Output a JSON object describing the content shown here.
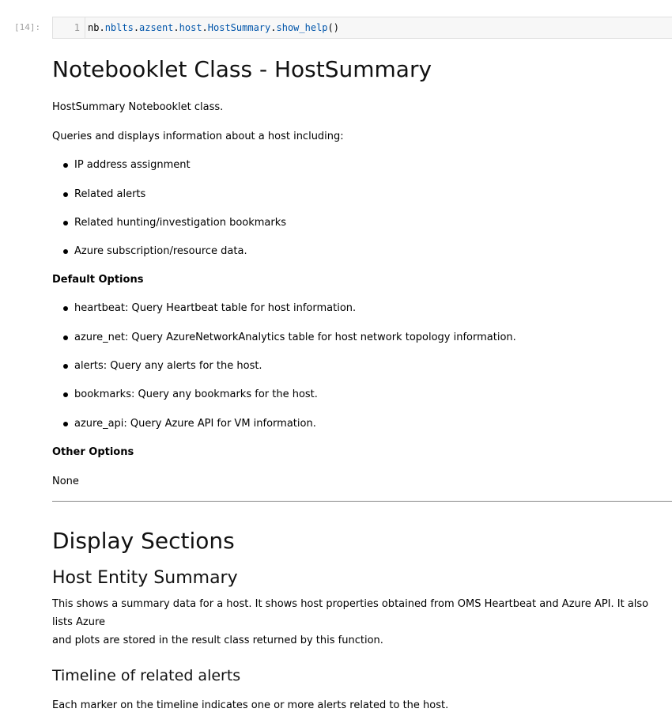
{
  "cell": {
    "prompt": "[14]:",
    "line_number": "1",
    "code_parts": [
      "nb.",
      "nblts",
      ".",
      "azsent",
      ".",
      "host",
      ".",
      "HostSummary",
      ".",
      "show_help",
      "()"
    ]
  },
  "doc": {
    "title": "Notebooklet Class - HostSummary",
    "intro1": "HostSummary Notebooklet class.",
    "intro2": "Queries and displays information about a host including:",
    "features": [
      "IP address assignment",
      "Related alerts",
      "Related hunting/investigation bookmarks",
      "Azure subscription/resource data."
    ],
    "default_options_heading": "Default Options",
    "default_options": [
      "heartbeat: Query Heartbeat table for host information.",
      "azure_net: Query AzureNetworkAnalytics table for host network topology information.",
      "alerts: Query any alerts for the host.",
      "bookmarks: Query any bookmarks for the host.",
      "azure_api: Query Azure API for VM information."
    ],
    "other_options_heading": "Other Options",
    "other_options_value": "None",
    "display_sections_heading": "Display Sections",
    "host_entity_heading": "Host Entity Summary",
    "host_entity_line1": "This shows a summary data for a host. It shows host properties obtained from OMS Heartbeat and Azure API. It also lists Azure",
    "host_entity_line2": "and plots are stored in the result class returned by this function.",
    "timeline_heading": "Timeline of related alerts",
    "timeline_text": "Each marker on the timeline indicates one or more alerts related to the host."
  }
}
